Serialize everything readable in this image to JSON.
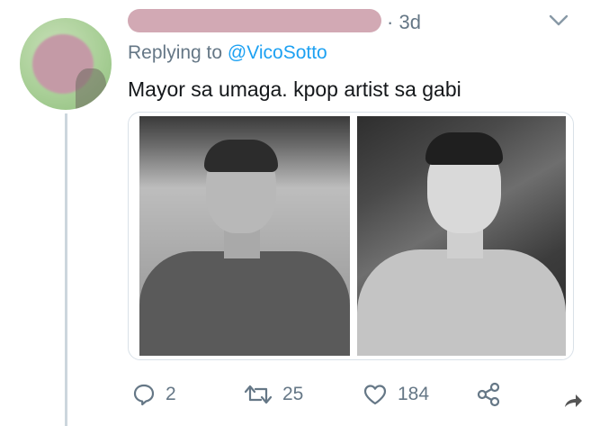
{
  "tweet": {
    "time": "3d",
    "reply_prefix": "Replying to",
    "reply_handle": "@VicoSotto",
    "text": "Mayor sa umaga. kpop artist sa gabi"
  },
  "media": {
    "left_photo_label": "photo-left",
    "right_photo_label": "photo-right"
  },
  "actions": {
    "replies": "2",
    "retweets": "25",
    "likes": "184"
  },
  "icons": {
    "reply": "reply-icon",
    "retweet": "retweet-icon",
    "like": "heart-icon",
    "share": "share-icon",
    "more": "chevron-down-icon",
    "forward": "forward-arrow-icon"
  },
  "colors": {
    "link": "#1da1f2",
    "muted": "#657786",
    "text": "#14171a",
    "thread_line": "#ccd6dd"
  }
}
